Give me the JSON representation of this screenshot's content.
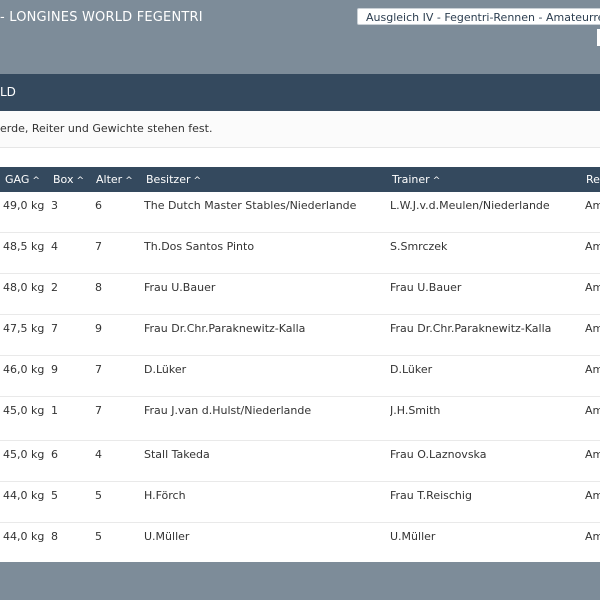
{
  "header": {
    "event_title": "- LONGINES WORLD FEGENTRI",
    "race_select": "Ausgleich IV - Fegentri-Rennen - Amateurrennen"
  },
  "panel": {
    "title": "LD",
    "info": "erde, Reiter und Gewichte stehen fest."
  },
  "table": {
    "columns": [
      {
        "key": "gag",
        "label": "GAG",
        "sort": "^"
      },
      {
        "key": "box",
        "label": "Box",
        "sort": "^"
      },
      {
        "key": "alter",
        "label": "Alter",
        "sort": "^"
      },
      {
        "key": "besitzer",
        "label": "Besitzer",
        "sort": "^"
      },
      {
        "key": "trainer",
        "label": "Trainer",
        "sort": "^"
      },
      {
        "key": "re",
        "label": "Re",
        "sort": ""
      }
    ],
    "rows": [
      {
        "gag": "49,0 kg",
        "box": "3",
        "alter": "6",
        "besitzer": "The Dutch Master Stables/Niederlande",
        "trainer": "L.W.J.v.d.Meulen/Niederlande",
        "re": "Am"
      },
      {
        "gag": "48,5 kg",
        "box": "4",
        "alter": "7",
        "besitzer": "Th.Dos Santos Pinto",
        "trainer": "S.Smrczek",
        "re": "Am"
      },
      {
        "gag": "48,0 kg",
        "box": "2",
        "alter": "8",
        "besitzer": "Frau U.Bauer",
        "trainer": "Frau U.Bauer",
        "re": "Am"
      },
      {
        "gag": "47,5 kg",
        "box": "7",
        "alter": "9",
        "besitzer": "Frau Dr.Chr.Paraknewitz-Kalla",
        "trainer": "Frau Dr.Chr.Paraknewitz-Kalla",
        "re": "Am"
      },
      {
        "gag": "46,0 kg",
        "box": "9",
        "alter": "7",
        "besitzer": "D.Lüker",
        "trainer": "D.Lüker",
        "re": "Am"
      },
      {
        "gag": "45,0 kg",
        "box": "1",
        "alter": "7",
        "besitzer": "Frau J.van d.Hulst/Niederlande",
        "trainer": "J.H.Smith",
        "re": "Am"
      },
      {
        "gag": "45,0 kg",
        "box": "6",
        "alter": "4",
        "besitzer": "Stall Takeda",
        "trainer": "Frau O.Laznovska",
        "re": "Am"
      },
      {
        "gag": "44,0 kg",
        "box": "5",
        "alter": "5",
        "besitzer": "H.Förch",
        "trainer": "Frau T.Reischig",
        "re": "Am"
      },
      {
        "gag": "44,0 kg",
        "box": "8",
        "alter": "5",
        "besitzer": "U.Müller",
        "trainer": "U.Müller",
        "re": "Am"
      }
    ]
  }
}
